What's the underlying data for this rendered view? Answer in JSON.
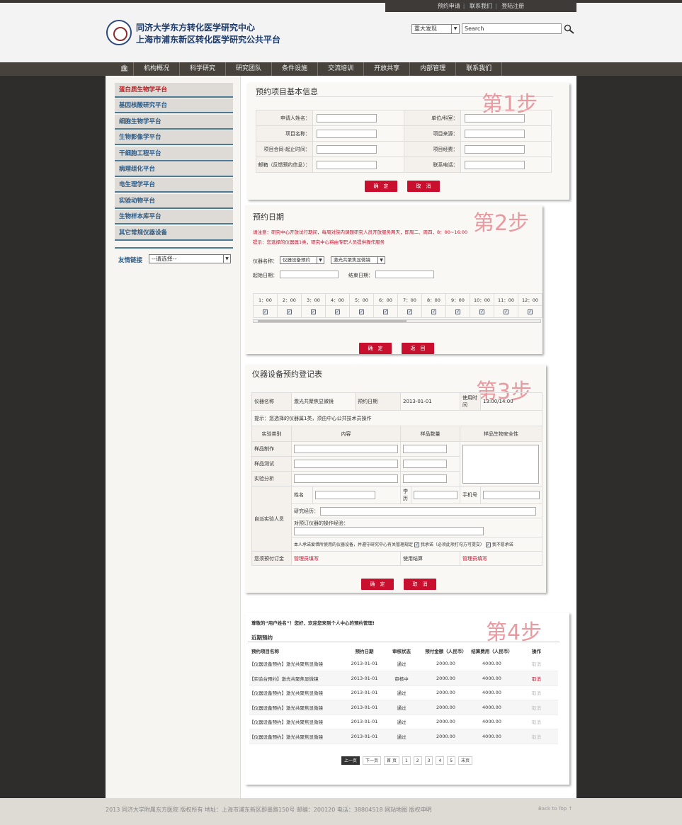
{
  "header": {
    "links": [
      "预约申请",
      "联系我们",
      "登陆注册"
    ],
    "title_line1": "同济大学东方转化医学研究中心",
    "title_line2": "上海市浦东新区转化医学研究公共平台",
    "category_select": "重大发现",
    "search_placeholder": "Search"
  },
  "nav": {
    "items": [
      "机构概况",
      "科学研究",
      "研究团队",
      "条件设施",
      "交流培训",
      "开放共享",
      "内部管理",
      "联系我们"
    ]
  },
  "sidebar": {
    "items": [
      "蛋白质生物学平台",
      "基因核酸研究平台",
      "细胞生物学平台",
      "生物影像学平台",
      "干细胞工程平台",
      "病理组化平台",
      "电生理学平台",
      "实验动物平台",
      "生物样本库平台",
      "其它常规仪器设备"
    ],
    "friend_links_label": "友情链接",
    "friend_links_select": "--请选择--"
  },
  "step1": {
    "title": "预约项目基本信息",
    "step": "第1步",
    "fields": [
      [
        "申请人姓名：",
        "单位/科室："
      ],
      [
        "项目名称：",
        "项目来源："
      ],
      [
        "项目合同-起止时间：",
        "项目经费："
      ],
      [
        "邮箱（反馈预约信息）：",
        "联系电话："
      ]
    ],
    "confirm": "确　定",
    "cancel": "取　消"
  },
  "step2": {
    "title": "预约日期",
    "step": "第2步",
    "notice": "请注意：研究中心开放试行期间，每周对院内课题研究人员开放服务两天，即周二、周四，8：00~16:00",
    "tip": "提示：您选择的仪器属1类，研究中心将由专职人员提供操作服务",
    "instrument_label": "仪器名称：",
    "instrument_sel1": "仪器设备预约",
    "instrument_sel2": "激光共聚焦显微镜",
    "start_label": "起始日期：",
    "end_label": "结束日期：",
    "hours": [
      "1：00",
      "2：00",
      "3：00",
      "4：00",
      "5：00",
      "6：00",
      "7：00",
      "8：00",
      "9：00",
      "10：00",
      "11：00",
      "12：00"
    ],
    "confirm": "确　定",
    "back": "返　回"
  },
  "step3": {
    "title": "仪器设备预约登记表",
    "step": "第3步",
    "instrument_label": "仪器名称",
    "instrument_value": "激光共聚焦显微镜",
    "date_label": "预约日期",
    "date_value": "2013-01-01",
    "time_label": "使用时间",
    "time_value": "13:00/14:00",
    "tip": "提示：您选择的仪器属1类，须由中心公共技术员操作",
    "col_type": "实验类别",
    "col_content": "内容",
    "col_qty": "样品数量",
    "col_safety": "样品生物安全性",
    "rows": [
      "样品制作",
      "样品测试",
      "实验分析"
    ],
    "self_label": "自派实验人员",
    "name_label": "姓名",
    "edu_label": "学历",
    "phone_label": "手机号",
    "exp_label": "研究经历：",
    "op_label": "对预订仪器的操作经验：",
    "promise": "本人承诺爱惜所使用的仪器设备，并遵守研究中心有关管理规定",
    "agree": "我承诺（必须此项打勾方可提交）",
    "disagree": "我不愿承诺",
    "fee_label": "您须预付订金",
    "fee_value": "管理员填写",
    "settle_label": "使用结算",
    "settle_value": "管理员填写",
    "confirm": "确　定",
    "cancel": "取　消"
  },
  "step4": {
    "step": "第4步",
    "welcome": "尊敬的“用户姓名”！您好，欢迎您来到个人中心的预约管理!",
    "recent": "近期预约",
    "headers": [
      "预约项目名称",
      "预约日期",
      "审核状态",
      "预付金额（人民币）",
      "结算费用（人民币）",
      "操作"
    ],
    "rows": [
      [
        "【仪器设备预约】激光共聚焦显微镜",
        "2013-01-01",
        "通过",
        "2000.00",
        "4000.00",
        "取消"
      ],
      [
        "【实验台预约】激光共聚焦显微镜",
        "2013-01-01",
        "审核中",
        "2000.00",
        "4000.00",
        "取消"
      ],
      [
        "【仪器设备预约】激光共聚焦显微镜",
        "2013-01-01",
        "通过",
        "2000.00",
        "4000.00",
        "取消"
      ],
      [
        "【仪器设备预约】激光共聚焦显微镜",
        "2013-01-01",
        "通过",
        "2000.00",
        "4000.00",
        "取消"
      ],
      [
        "【仪器设备预约】激光共聚焦显微镜",
        "2013-01-01",
        "通过",
        "2000.00",
        "4000.00",
        "取消"
      ],
      [
        "【仪器设备预约】激光共聚焦显微镜",
        "2013-01-01",
        "通过",
        "2000.00",
        "4000.00",
        "取消"
      ]
    ],
    "pagination": [
      "上一页",
      "下一页",
      "首 页",
      "1",
      "2",
      "3",
      "4",
      "5",
      "末页"
    ]
  },
  "footer": {
    "text": "2013 同济大学附属东方医院 版权所有 地址：上海市浦东新区即墨路150号 邮编：200120 电话：38804518 网站地图 版权申明",
    "back_to_top": "Back to Top ↑"
  }
}
